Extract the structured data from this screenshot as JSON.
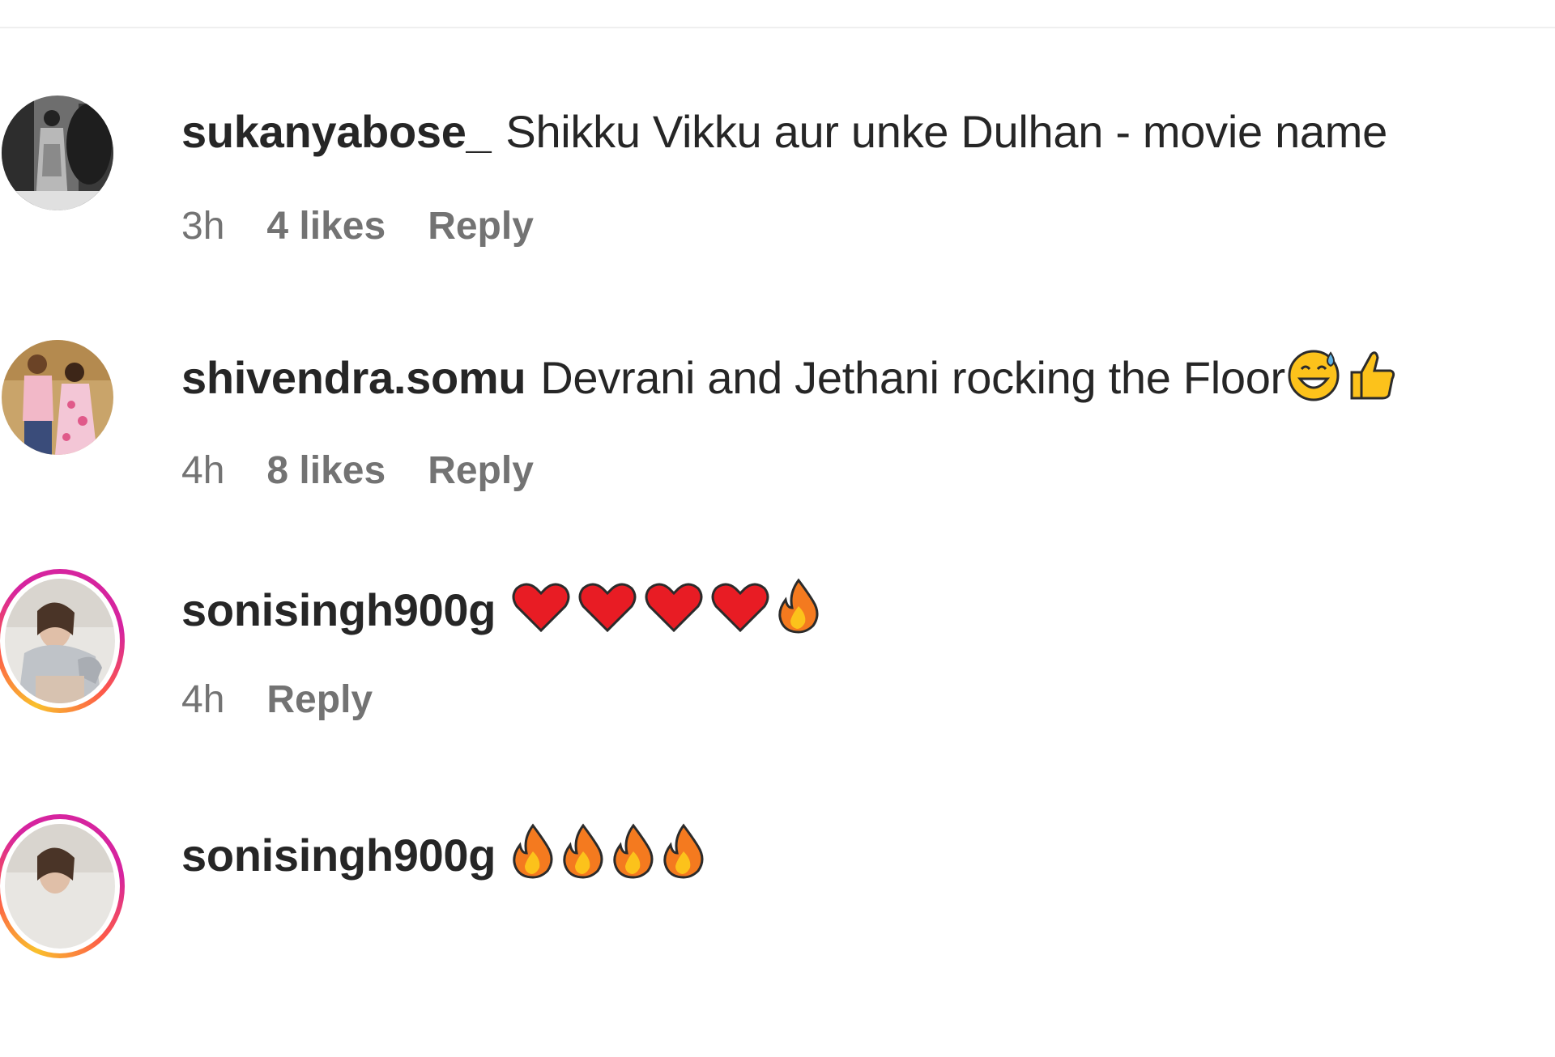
{
  "comments": [
    {
      "username": "sukanyabose_",
      "text": "Shikku Vikku aur unke Dulhan - movie name",
      "time": "3h",
      "likes": "4 likes",
      "reply_label": "Reply",
      "avatar": "profile-photo-bw",
      "story_ring": false
    },
    {
      "username": "shivendra.somu",
      "text": "Devrani and Jethani rocking the Floor",
      "emojis": [
        "grinning-sweat-emoji",
        "thumbs-up-emoji"
      ],
      "time": "4h",
      "likes": "8 likes",
      "reply_label": "Reply",
      "avatar": "profile-photo-couple",
      "story_ring": false
    },
    {
      "username": "sonisingh900g",
      "text": "",
      "emojis": [
        "red-heart-emoji",
        "red-heart-emoji",
        "red-heart-emoji",
        "red-heart-emoji",
        "fire-emoji"
      ],
      "time": "4h",
      "reply_label": "Reply",
      "avatar": "profile-photo-woman",
      "story_ring": true
    },
    {
      "username": "sonisingh900g",
      "text": "",
      "emojis": [
        "fire-emoji",
        "fire-emoji",
        "fire-emoji",
        "fire-emoji"
      ],
      "avatar": "profile-photo-woman",
      "story_ring": true
    }
  ],
  "colors": {
    "text": "#262626",
    "secondary": "#737373",
    "divider": "#efefef",
    "ring_gradient": [
      "#f9c02c",
      "#fd5949",
      "#d6249f"
    ]
  }
}
